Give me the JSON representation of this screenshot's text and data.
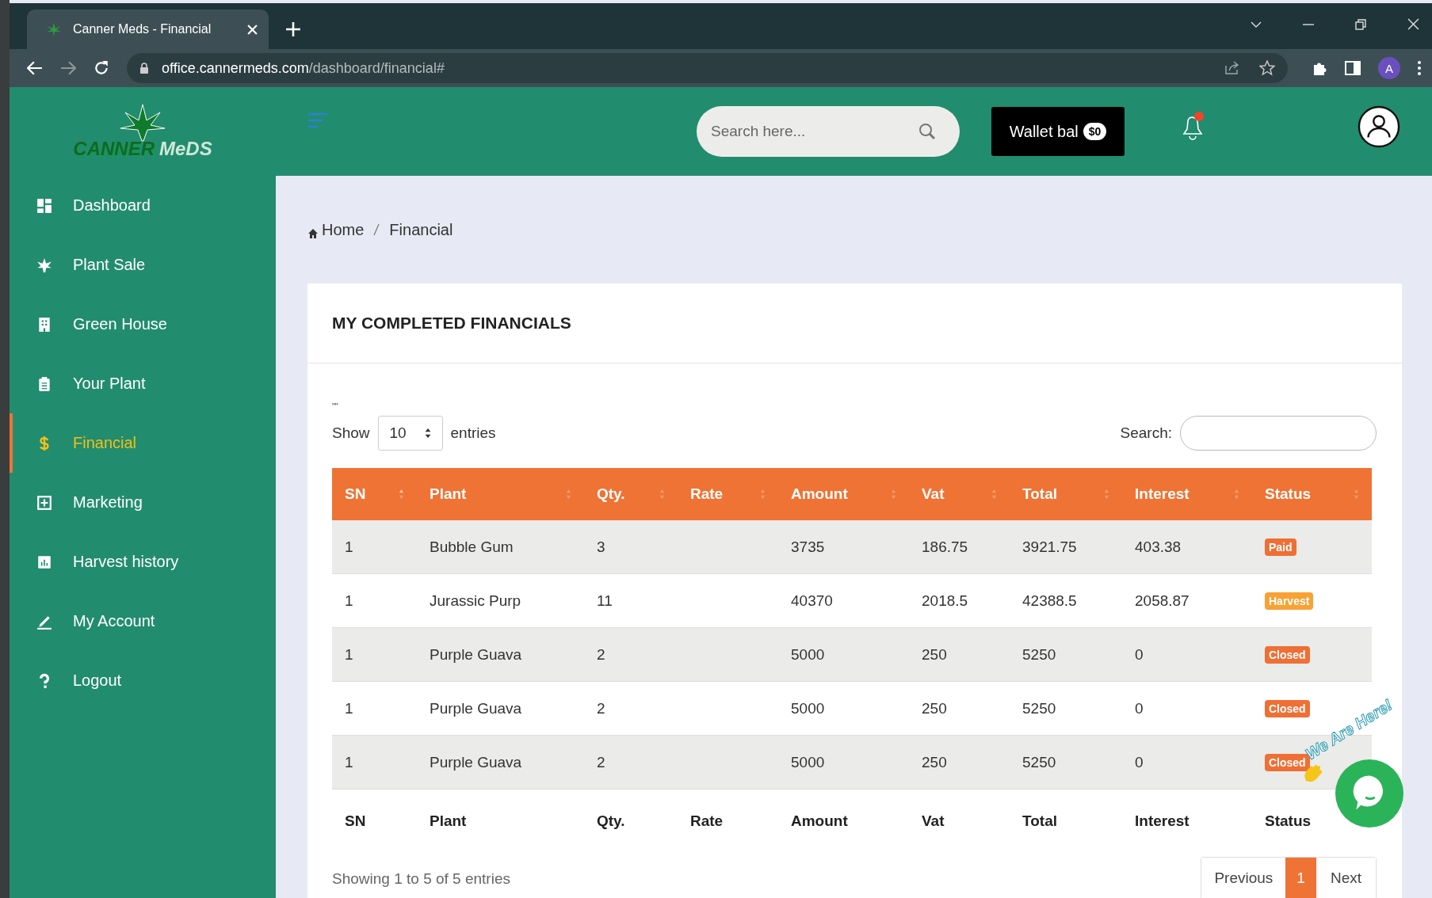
{
  "browser": {
    "tab_title": "Canner Meds - Financial",
    "url_host": "office.cannermeds.com",
    "url_path": "/dashboard/financial#",
    "profile_initial": "A"
  },
  "sidebar": {
    "logo_left": "CANNER",
    "logo_right": "MeDS",
    "items": [
      {
        "label": "Dashboard",
        "selected": false
      },
      {
        "label": "Plant Sale",
        "selected": false
      },
      {
        "label": "Green House",
        "selected": false
      },
      {
        "label": "Your Plant",
        "selected": false
      },
      {
        "label": "Financial",
        "selected": true
      },
      {
        "label": "Marketing",
        "selected": false
      },
      {
        "label": "Harvest history",
        "selected": false
      },
      {
        "label": "My Account",
        "selected": false
      },
      {
        "label": "Logout",
        "selected": false
      }
    ]
  },
  "header": {
    "search_placeholder": "Search here...",
    "wallet_label": "Wallet bal",
    "wallet_amount": "$0",
    "notification_dot": true
  },
  "breadcrumb": [
    "Home",
    "Financial"
  ],
  "card": {
    "title": "MY COMPLETED FINANCIALS",
    "note": "''''",
    "show_label": "Show",
    "page_size": "10",
    "entries_label": "entries",
    "search_label": "Search:",
    "columns": [
      {
        "label": "SN",
        "sorted": true
      },
      {
        "label": "Plant",
        "sorted": false
      },
      {
        "label": "Qty.",
        "sorted": false
      },
      {
        "label": "Rate",
        "sorted": false
      },
      {
        "label": "Amount",
        "sorted": false
      },
      {
        "label": "Vat",
        "sorted": false
      },
      {
        "label": "Total",
        "sorted": false
      },
      {
        "label": "Interest",
        "sorted": false
      },
      {
        "label": "Status",
        "sorted": false
      }
    ],
    "rows": [
      {
        "cells": [
          "1",
          "Bubble Gum",
          "3",
          "",
          "3735",
          "186.75",
          "3921.75",
          "403.38"
        ],
        "status": {
          "text": "Paid",
          "color": "#ef6f35"
        }
      },
      {
        "cells": [
          "1",
          "Jurassic Purp",
          "11",
          "",
          "40370",
          "2018.5",
          "42388.5",
          "2058.87"
        ],
        "status": {
          "text": "Harvest",
          "color": "#f7a234"
        }
      },
      {
        "cells": [
          "1",
          "Purple Guava",
          "2",
          "",
          "5000",
          "250",
          "5250",
          "0"
        ],
        "status": {
          "text": "Closed",
          "color": "#ef6f35"
        }
      },
      {
        "cells": [
          "1",
          "Purple Guava",
          "2",
          "",
          "5000",
          "250",
          "5250",
          "0"
        ],
        "status": {
          "text": "Closed",
          "color": "#ef6f35"
        }
      },
      {
        "cells": [
          "1",
          "Purple Guava",
          "2",
          "",
          "5000",
          "250",
          "5250",
          "0"
        ],
        "status": {
          "text": "Closed",
          "color": "#ef6f35"
        }
      }
    ],
    "footer_columns": [
      "SN",
      "Plant",
      "Qty.",
      "Rate",
      "Amount",
      "Vat",
      "Total",
      "Interest",
      "Status"
    ],
    "info": "Showing 1 to 5 of 5 entries",
    "pagination": [
      {
        "label": "Previous",
        "kind": "prev",
        "selected": false
      },
      {
        "label": "1",
        "kind": "page",
        "selected": true
      },
      {
        "label": "Next",
        "kind": "next",
        "selected": false
      }
    ]
  },
  "chat": {
    "tagline": "We Are Here!"
  }
}
